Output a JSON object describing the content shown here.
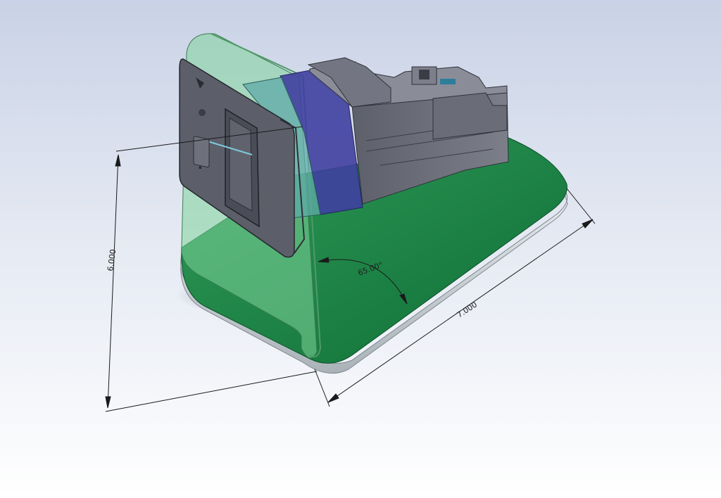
{
  "viewport": {
    "background_top": "#c9d2e6",
    "background_bottom": "#ffffff"
  },
  "model": {
    "stand_color": "#1e8a4a",
    "stand_translucent_color": "#7fd39a",
    "collar_color": "#3f3fa0",
    "housing_color": "#6b6e7a"
  },
  "dimensions": {
    "height_label": "6.000",
    "length_label": "7.000",
    "angle_label": "65.00°"
  }
}
